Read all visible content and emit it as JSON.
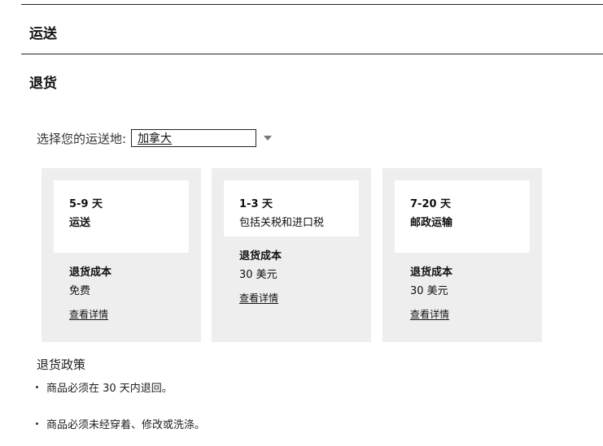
{
  "sections": {
    "shipping_heading": "运送",
    "returns_heading": "退货"
  },
  "destination": {
    "label": "选择您的运送地:",
    "selected": "加拿大"
  },
  "cards": [
    {
      "days": "5-9 天",
      "method": "运送",
      "return_cost_label": "退货成本",
      "return_cost": "免费",
      "details_link": "查看详情"
    },
    {
      "days": "1-3 天",
      "method": "包括关税和进口税",
      "return_cost_label": "退货成本",
      "return_cost": "30 美元",
      "details_link": "查看详情"
    },
    {
      "days": "7-20 天",
      "method": "邮政运输",
      "return_cost_label": "退货成本",
      "return_cost": "30 美元",
      "details_link": "查看详情"
    }
  ],
  "policy": {
    "title": "退货政策",
    "items": [
      "商品必须在 30 天内退回。",
      "商品必须未经穿着、修改或洗涤。"
    ]
  },
  "icons": {
    "dropdown": "caret-down-icon"
  },
  "colors": {
    "card_bg": "#eeeeee",
    "text": "#111111"
  }
}
